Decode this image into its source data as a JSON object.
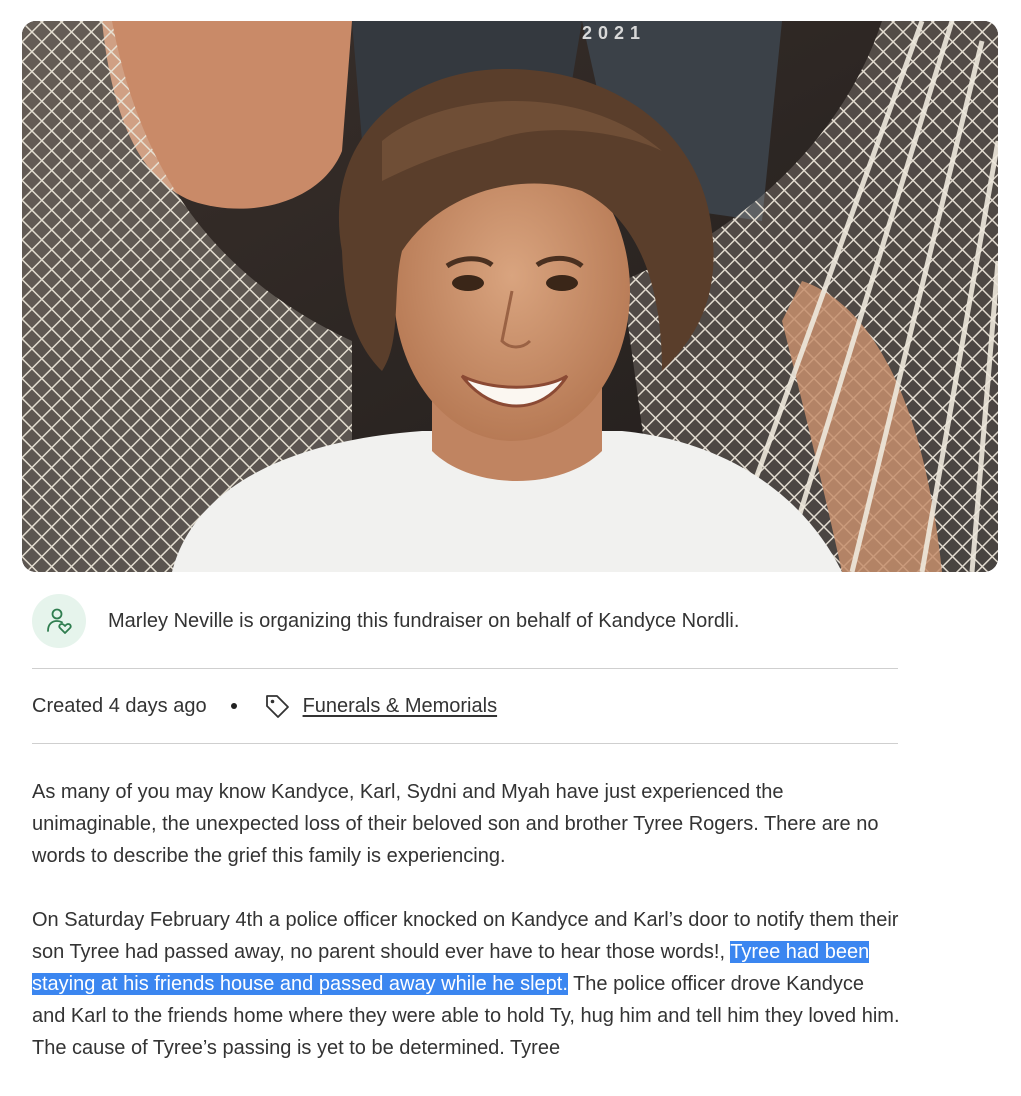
{
  "hero": {
    "image_alt": "Smiling teenage boy with shoulder-length brown hair lying in a white rope hammock",
    "shirt_print": "2021"
  },
  "organizer": {
    "icon": "heart-person-icon",
    "text": "Marley Neville is organizing this fundraiser on behalf of Kandyce Nordli."
  },
  "meta": {
    "created": "Created 4 days ago",
    "category_icon": "tag-icon",
    "category": "Funerals & Memorials"
  },
  "story": {
    "p1": "As many of you may know Kandyce, Karl, Sydni and Myah have just experienced the unimaginable, the unexpected loss of their beloved son and brother Tyree Rogers. There are no words to describe the grief this family is experiencing.",
    "p2_before": "On Saturday February 4th a police officer knocked on Kandyce and Karl’s door to notify them their son Tyree had passed away, no parent should ever have to hear those words!, ",
    "p2_highlight": "Tyree had been staying at his friends house and passed away while he slept.",
    "p2_after": " The police officer drove Kandyce and Karl to the friends home where they were able to hold Ty, hug him and tell him they loved him. The cause of Tyree’s passing is yet to be determined. Tyree"
  },
  "colors": {
    "accent_green": "#2f7d4f",
    "avatar_bg": "#e6f4ec",
    "selection_blue": "#3b86f0"
  }
}
